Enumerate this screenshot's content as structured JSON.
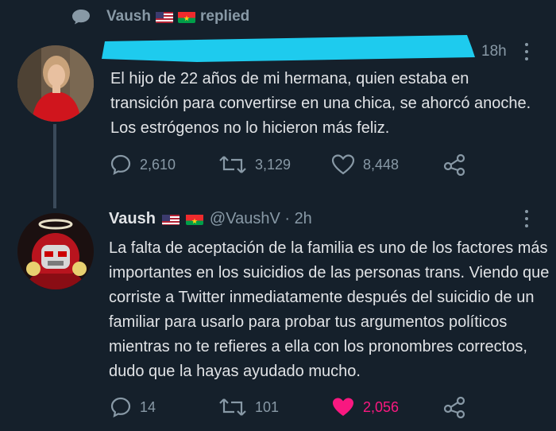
{
  "header": {
    "author": "Vaush",
    "replied_label": "replied"
  },
  "tweet1": {
    "time": "18h",
    "text": "El hijo de 22 años de mi hermana, quien estaba en transición para convertirse en una chica, se ahorcó anoche. Los estrógenos no lo hicieron más feliz.",
    "replies": "2,610",
    "retweets": "3,129",
    "likes": "8,448"
  },
  "tweet2": {
    "name": "Vaush",
    "handle": "@VaushV · 2h",
    "text": "La falta de aceptación de la familia es uno de los factores más importantes en los suicidios de las personas trans. Viendo que corriste a Twitter inmediatamente después del suicidio de un familiar para usarlo para probar tus argumentos políticos mientras no te refieres a ella con los pronombres correctos, dudo que la hayas ayudado mucho.",
    "replies": "14",
    "retweets": "101",
    "likes": "2,056"
  },
  "colors": {
    "background": "#15202b",
    "muted": "#8899a6",
    "like_active": "#f91880",
    "redaction": "#1ecbee"
  },
  "icons": [
    "reply-bubble-icon",
    "us-flag-icon",
    "burkina-faso-flag-icon",
    "retweet-icon",
    "heart-icon",
    "share-icon",
    "more-options-icon"
  ]
}
